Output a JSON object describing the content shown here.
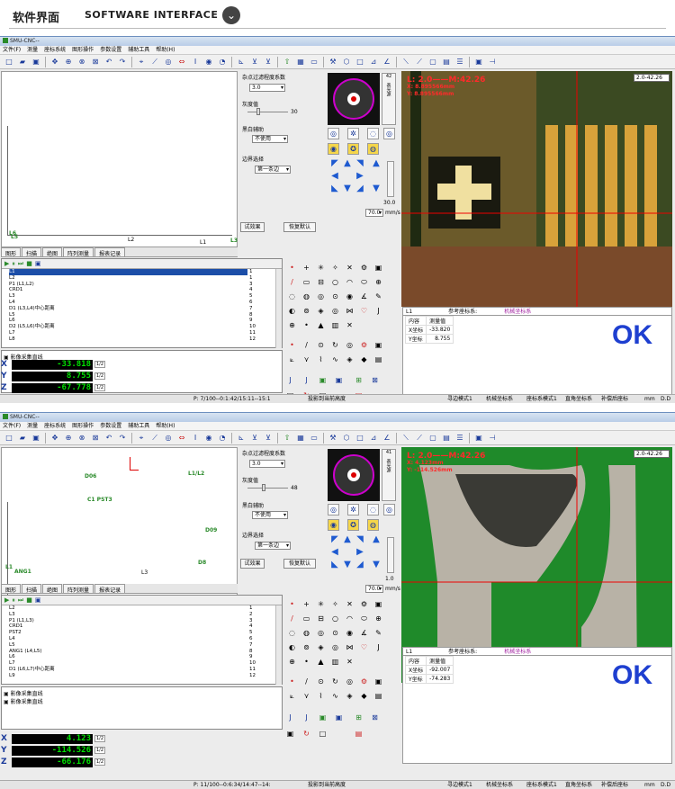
{
  "header": {
    "title_cn": "软件界面",
    "title_en": "SOFTWARE INTERFACE",
    "dropdown_icon": "chevron-down-icon"
  },
  "windows": [
    {
      "title": "SMU-CNC--",
      "menu": [
        "文件(F)",
        "测量",
        "座标系统",
        "图形操作",
        "参数设置",
        "辅助工具",
        "帮助(H)"
      ],
      "plot_labels": [
        "L2",
        "L1",
        "L6",
        "L5",
        "L3"
      ],
      "tabs": [
        "图形",
        "扫描",
        "绝图",
        "阵列测量",
        "报表记录"
      ],
      "ctrl": {
        "noise_title": "杂点过滤程度系数",
        "noise_value": "3.0",
        "gray_title": "灰度值",
        "gray_value": "30",
        "bw_title": "黑白辅助",
        "bw_value": "不使用",
        "edge_title": "边界选择",
        "edge_value": "第一条边",
        "test_btn": "试效果",
        "reset_btn": "恢复默认"
      },
      "cam": {
        "slider_value": "42",
        "light_label": "表光源",
        "speed_value": "30.0",
        "feed_value": "70.0",
        "feed_unit": "mm/s"
      },
      "zoom": "2.0-42.26",
      "video_info": {
        "l": "L: 2.0——M:42.26",
        "x": "X: 8.895566mm",
        "y": "Y: 8.895566mm"
      },
      "point_list": [
        {
          "label": "L1",
          "num": "1",
          "sel": true
        },
        {
          "label": "L2",
          "num": "1"
        },
        {
          "label": "P1 (L1,L2)",
          "num": "3"
        },
        {
          "label": "CRD1",
          "num": "4"
        },
        {
          "label": "L3",
          "num": "5"
        },
        {
          "label": "L4",
          "num": "6"
        },
        {
          "label": "D1 (L3,L4)中心距离",
          "num": "7"
        },
        {
          "label": "L5",
          "num": "8"
        },
        {
          "label": "L6",
          "num": "9"
        },
        {
          "label": "D2 (L5,L6)中心距离",
          "num": "10"
        },
        {
          "label": "L7",
          "num": "11"
        },
        {
          "label": "L8",
          "num": "12"
        }
      ],
      "comment": "影像采集直线",
      "coords": {
        "x": "-33.818",
        "y": "8.755",
        "z": "-67.778",
        "unit": "1/2"
      },
      "meas": {
        "name": "L1",
        "ref_label": "参考座标系:",
        "ref_value": "机械坐标系",
        "col1": "内容",
        "col2": "测量值",
        "rows": [
          [
            "X坐标",
            "-33.820"
          ],
          [
            "Y坐标",
            "8.755"
          ]
        ],
        "ok": "OK"
      },
      "status": {
        "progress": "P: 7/100--0:1:42/15:11--15:1",
        "proj": "投影到当前高度",
        "mode": "寻边模式1",
        "mach": "机械坐标系",
        "coord": "座标系模式1",
        "rect": "直角坐标系",
        "comp": "补偿后座标",
        "mm": "mm",
        "dd": "D.D"
      }
    },
    {
      "title": "SMU-CNC--",
      "menu": [
        "文件(F)",
        "测量",
        "座标系统",
        "图形操作",
        "参数设置",
        "辅助工具",
        "帮助(H)"
      ],
      "plot_labels": [
        "D06",
        "L1/L2",
        "C1 PST3",
        "D09",
        "D8",
        "L1",
        "ANG1",
        "L3"
      ],
      "tabs": [
        "图形",
        "扫描",
        "绝图",
        "阵列测量",
        "报表记录"
      ],
      "ctrl": {
        "noise_title": "杂点过滤程度系数",
        "noise_value": "3.0",
        "gray_title": "灰度值",
        "gray_value": "48",
        "bw_title": "黑白辅助",
        "bw_value": "不使用",
        "edge_title": "边界选择",
        "edge_value": "第一条边",
        "test_btn": "试效果",
        "reset_btn": "恢复默认"
      },
      "cam": {
        "slider_value": "41",
        "light_label": "表光源",
        "speed_value": "1.0",
        "feed_value": "70.0",
        "feed_unit": "mm/s"
      },
      "zoom": "2.0-42.26",
      "video_info": {
        "l": "L: 2.0——M:42.26",
        "x": "X: 4.123mm",
        "y": "Y: -114.526mm"
      },
      "point_list": [
        {
          "label": "L2",
          "num": "1"
        },
        {
          "label": "L3",
          "num": "2"
        },
        {
          "label": "P1 (L1,L3)",
          "num": "3"
        },
        {
          "label": "CRD1",
          "num": "4"
        },
        {
          "label": "PST2",
          "num": "5"
        },
        {
          "label": "L4",
          "num": "6"
        },
        {
          "label": "L5",
          "num": "7"
        },
        {
          "label": "ANG1 (L4,L5)",
          "num": "8"
        },
        {
          "label": "L6",
          "num": "9"
        },
        {
          "label": "L7",
          "num": "10"
        },
        {
          "label": "D1 (L6,L7)中心距离",
          "num": "11"
        },
        {
          "label": "L9",
          "num": "12"
        }
      ],
      "comment": "影像采集直线",
      "comment2": "影像采集直线",
      "coords": {
        "x": "4.123",
        "y": "-114.526",
        "z": "-66.176",
        "unit": "1/2"
      },
      "meas": {
        "name": "L1",
        "ref_label": "参考座标系:",
        "ref_value": "机械坐标系",
        "col1": "内容",
        "col2": "测量值",
        "rows": [
          [
            "X坐标",
            "-92.007"
          ],
          [
            "Y坐标",
            "-74.283"
          ]
        ],
        "ok": "OK"
      },
      "status": {
        "progress": "P: 11/100--0:6:34/14:47--14:",
        "proj": "投影到当前高度",
        "mode": "寻边模式1",
        "mach": "机械坐标系",
        "coord": "座标系模式1",
        "rect": "直角坐标系",
        "comp": "补偿后座标",
        "mm": "mm",
        "dd": "D.D"
      }
    }
  ]
}
